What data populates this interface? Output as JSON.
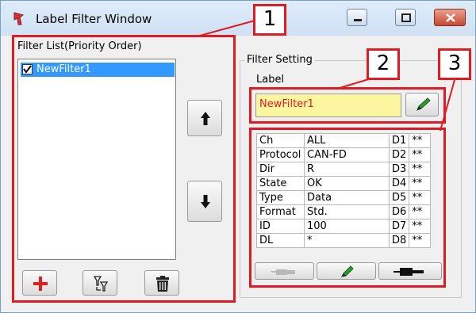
{
  "window": {
    "title": "Label Filter Window",
    "callouts": [
      "1",
      "2",
      "3"
    ]
  },
  "filter_list": {
    "heading": "Filter List(Priority Order)",
    "items": [
      {
        "label": "NewFilter1",
        "checked": true,
        "selected": true
      }
    ]
  },
  "filter_setting": {
    "heading": "Filter Setting",
    "label_caption": "Label",
    "label_value": "NewFilter1",
    "rows": [
      {
        "key": "Ch",
        "value": "ALL",
        "dkey": "D1",
        "dval": "**"
      },
      {
        "key": "Protocol",
        "value": "CAN-FD",
        "dkey": "D2",
        "dval": "**"
      },
      {
        "key": "Dir",
        "value": "R",
        "dkey": "D3",
        "dval": "**"
      },
      {
        "key": "State",
        "value": "OK",
        "dkey": "D4",
        "dval": "**"
      },
      {
        "key": "Type",
        "value": "Data",
        "dkey": "D5",
        "dval": "**"
      },
      {
        "key": "Format",
        "value": "Std.",
        "dkey": "D6",
        "dval": "**"
      },
      {
        "key": "ID",
        "value": "100",
        "dkey": "D7",
        "dval": "**"
      },
      {
        "key": "DL",
        "value": "*",
        "dkey": "D8",
        "dval": "**"
      }
    ]
  },
  "icons": {
    "app": "red-pin-icon",
    "move_up": "arrow-up-icon",
    "move_down": "arrow-down-icon",
    "add": "plus-icon",
    "sort": "filter-sort-icon",
    "delete": "trash-icon",
    "edit": "pencil-icon",
    "connect_disabled": "plug-icon",
    "connect": "connector-icon"
  },
  "colors": {
    "callout": "#e01b22",
    "selection": "#3399ff",
    "label_field_bg": "#fdf6a0",
    "label_field_text": "#e01b22",
    "add_icon": "#e01b22",
    "pencil": "#2e9a2e"
  }
}
